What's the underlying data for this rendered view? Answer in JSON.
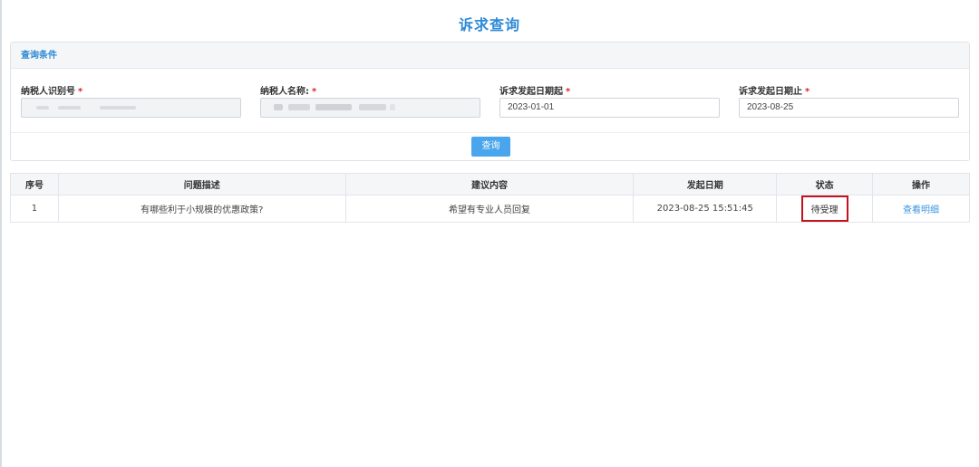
{
  "page": {
    "title": "诉求查询"
  },
  "query_panel": {
    "header": "查询条件",
    "fields": [
      {
        "label": "纳税人识别号",
        "required": "*",
        "value": ""
      },
      {
        "label": "纳税人名称:",
        "required": "*",
        "value": ""
      },
      {
        "label": "诉求发起日期起",
        "required": "*",
        "value": "2023-01-01"
      },
      {
        "label": "诉求发起日期止",
        "required": "*",
        "value": "2023-08-25"
      }
    ],
    "button": "查询"
  },
  "table": {
    "columns": [
      "序号",
      "问题描述",
      "建议内容",
      "发起日期",
      "状态",
      "操作"
    ],
    "rows": [
      {
        "index": "1",
        "question": "有哪些利于小规模的优惠政策?",
        "suggestion": "希望有专业人员回复",
        "date": "2023-08-25 15:51:45",
        "status": "待受理",
        "action": "查看明细"
      }
    ]
  },
  "colors": {
    "accent": "#2e8ad6",
    "button": "#4aa6ec",
    "required": "#e02424",
    "highlight_box": "#c0121f",
    "link": "#3a95e0"
  }
}
